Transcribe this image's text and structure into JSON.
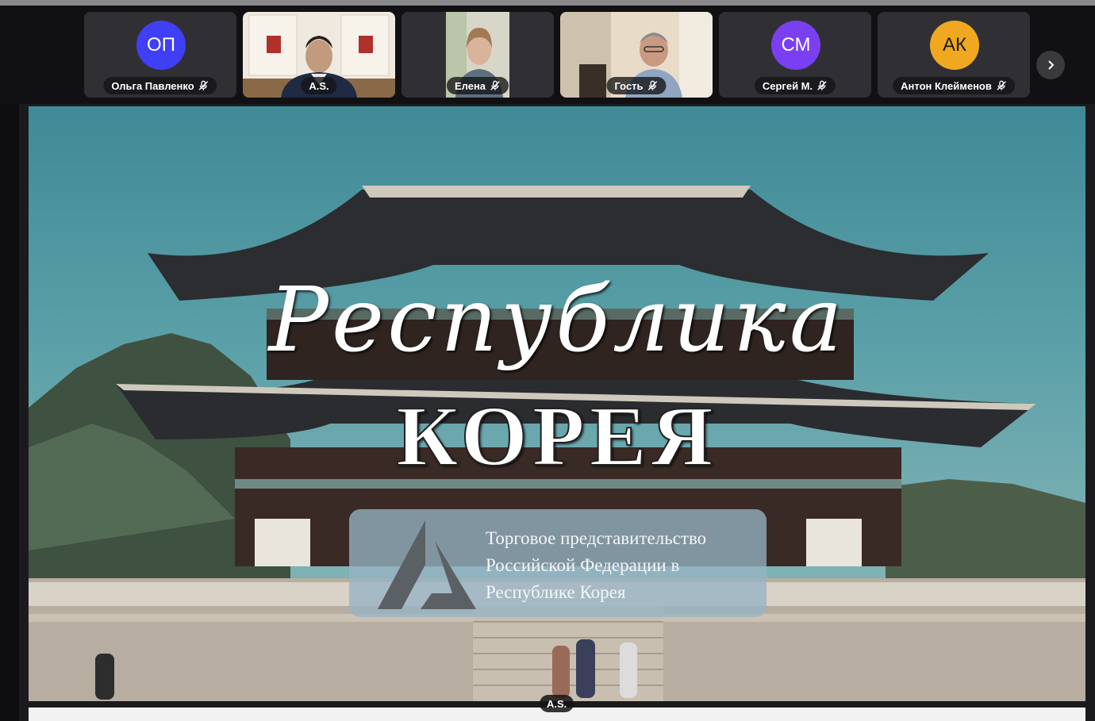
{
  "participants": [
    {
      "initials": "ОП",
      "name": "Ольга Павленко",
      "avatar_color": "#3f3ff5"
    },
    {
      "initials": "",
      "name": "A.S.",
      "avatar_color": ""
    },
    {
      "initials": "",
      "name": "Елена",
      "avatar_color": ""
    },
    {
      "initials": "",
      "name": "Гость",
      "avatar_color": ""
    },
    {
      "initials": "СМ",
      "name": "Сергей М.",
      "avatar_color": "#7b3ff2"
    },
    {
      "initials": "АК",
      "name": "Антон Клейменов",
      "avatar_color": "#f0a820"
    }
  ],
  "slide": {
    "title_script": "Республика",
    "title_caps": "КОРЕЯ",
    "org_lines": [
      "Торговое представительство",
      "Российской Федерации в",
      "Республике Корея"
    ]
  },
  "presenter_label": "A.S.",
  "icons": {
    "mic_muted": "mic-off-icon",
    "next": "chevron-right-icon"
  }
}
